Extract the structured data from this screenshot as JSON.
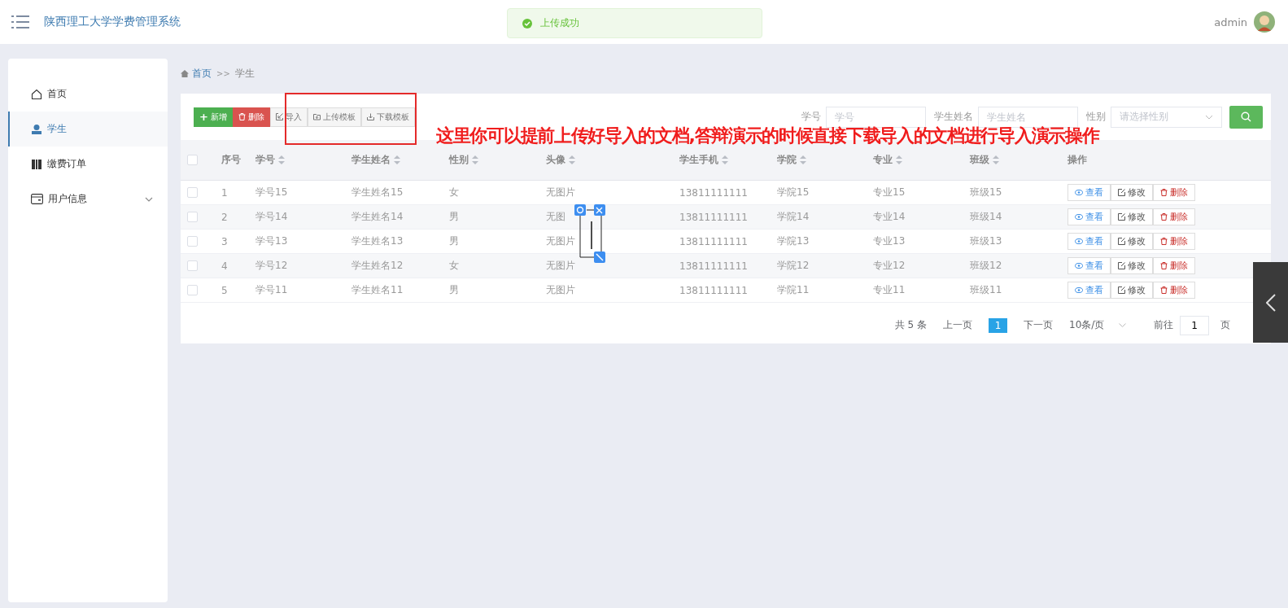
{
  "header": {
    "title": "陕西理工大学学费管理系统",
    "user": "admin"
  },
  "toast": {
    "text": "上传成功",
    "kind": "success"
  },
  "sidebar": {
    "items": [
      {
        "label": "首页",
        "selected": false,
        "expandable": false
      },
      {
        "label": "学生",
        "selected": true,
        "expandable": false
      },
      {
        "label": "缴费订单",
        "selected": false,
        "expandable": false
      },
      {
        "label": "用户信息",
        "selected": false,
        "expandable": true
      }
    ]
  },
  "breadcrumb": {
    "items": [
      {
        "label": "首页",
        "kind": "link"
      },
      {
        "label": "学生",
        "kind": "current"
      }
    ],
    "separator": ">>"
  },
  "toolbar": [
    {
      "label": "新增",
      "kind": "add",
      "icon_text": "+"
    },
    {
      "label": "删除",
      "kind": "delete"
    },
    {
      "label": "导入",
      "kind": "import"
    },
    {
      "label": "上传模板",
      "kind": "upload"
    },
    {
      "label": "下载模板",
      "kind": "download"
    }
  ],
  "filters": [
    {
      "label": "学号",
      "placeholder": "学号",
      "kind": "input"
    },
    {
      "label": "学生姓名",
      "placeholder": "学生姓名",
      "kind": "input"
    },
    {
      "label": "性别",
      "placeholder": "请选择性别",
      "kind": "select"
    }
  ],
  "table": {
    "all_checked": false,
    "columns": [
      {
        "label": "序号",
        "sortable": false
      },
      {
        "label": "学号",
        "sortable": true
      },
      {
        "label": "学生姓名",
        "sortable": true
      },
      {
        "label": "性别",
        "sortable": true
      },
      {
        "label": "头像",
        "sortable": true
      },
      {
        "label": "学生手机",
        "sortable": true
      },
      {
        "label": "学院",
        "sortable": true
      },
      {
        "label": "专业",
        "sortable": true
      },
      {
        "label": "班级",
        "sortable": true
      },
      {
        "label": "操作",
        "sortable": false
      }
    ],
    "rows": [
      {
        "checked": false,
        "cells": [
          "1",
          "学号15",
          "学生姓名15",
          "女",
          "无图片",
          "13811111111",
          "学院15",
          "专业15",
          "班级15"
        ],
        "actions": [
          {
            "label": "查看",
            "kind": "view"
          },
          {
            "label": "修改",
            "kind": "edit"
          },
          {
            "label": "删除",
            "kind": "delete"
          }
        ]
      },
      {
        "checked": false,
        "cells": [
          "2",
          "学号14",
          "学生姓名14",
          "男",
          "无图",
          "13811111111",
          "学院14",
          "专业14",
          "班级14"
        ],
        "actions": [
          {
            "label": "查看",
            "kind": "view"
          },
          {
            "label": "修改",
            "kind": "edit"
          },
          {
            "label": "删除",
            "kind": "delete"
          }
        ]
      },
      {
        "checked": false,
        "cells": [
          "3",
          "学号13",
          "学生姓名13",
          "男",
          "无图片",
          "13811111111",
          "学院13",
          "专业13",
          "班级13"
        ],
        "actions": [
          {
            "label": "查看",
            "kind": "view"
          },
          {
            "label": "修改",
            "kind": "edit"
          },
          {
            "label": "删除",
            "kind": "delete"
          }
        ]
      },
      {
        "checked": false,
        "cells": [
          "4",
          "学号12",
          "学生姓名12",
          "女",
          "无图片",
          "13811111111",
          "学院12",
          "专业12",
          "班级12"
        ],
        "actions": [
          {
            "label": "查看",
            "kind": "view"
          },
          {
            "label": "修改",
            "kind": "edit"
          },
          {
            "label": "删除",
            "kind": "delete"
          }
        ]
      },
      {
        "checked": false,
        "cells": [
          "5",
          "学号11",
          "学生姓名11",
          "男",
          "无图片",
          "13811111111",
          "学院11",
          "专业11",
          "班级11"
        ],
        "actions": [
          {
            "label": "查看",
            "kind": "view"
          },
          {
            "label": "修改",
            "kind": "edit"
          },
          {
            "label": "删除",
            "kind": "delete"
          }
        ]
      }
    ]
  },
  "pagination": {
    "total": "共 5 条",
    "prev": "上一页",
    "pages": [
      {
        "label": "1",
        "selected": true
      }
    ],
    "next": "下一页",
    "page_size": "10条/页",
    "goto": "前往",
    "goto_value": "1",
    "page_unit": "页"
  },
  "annotation": "这里你可以提前上传好导入的文档,答辩演示的时候直接下载导入的文档进行导入演示操作"
}
